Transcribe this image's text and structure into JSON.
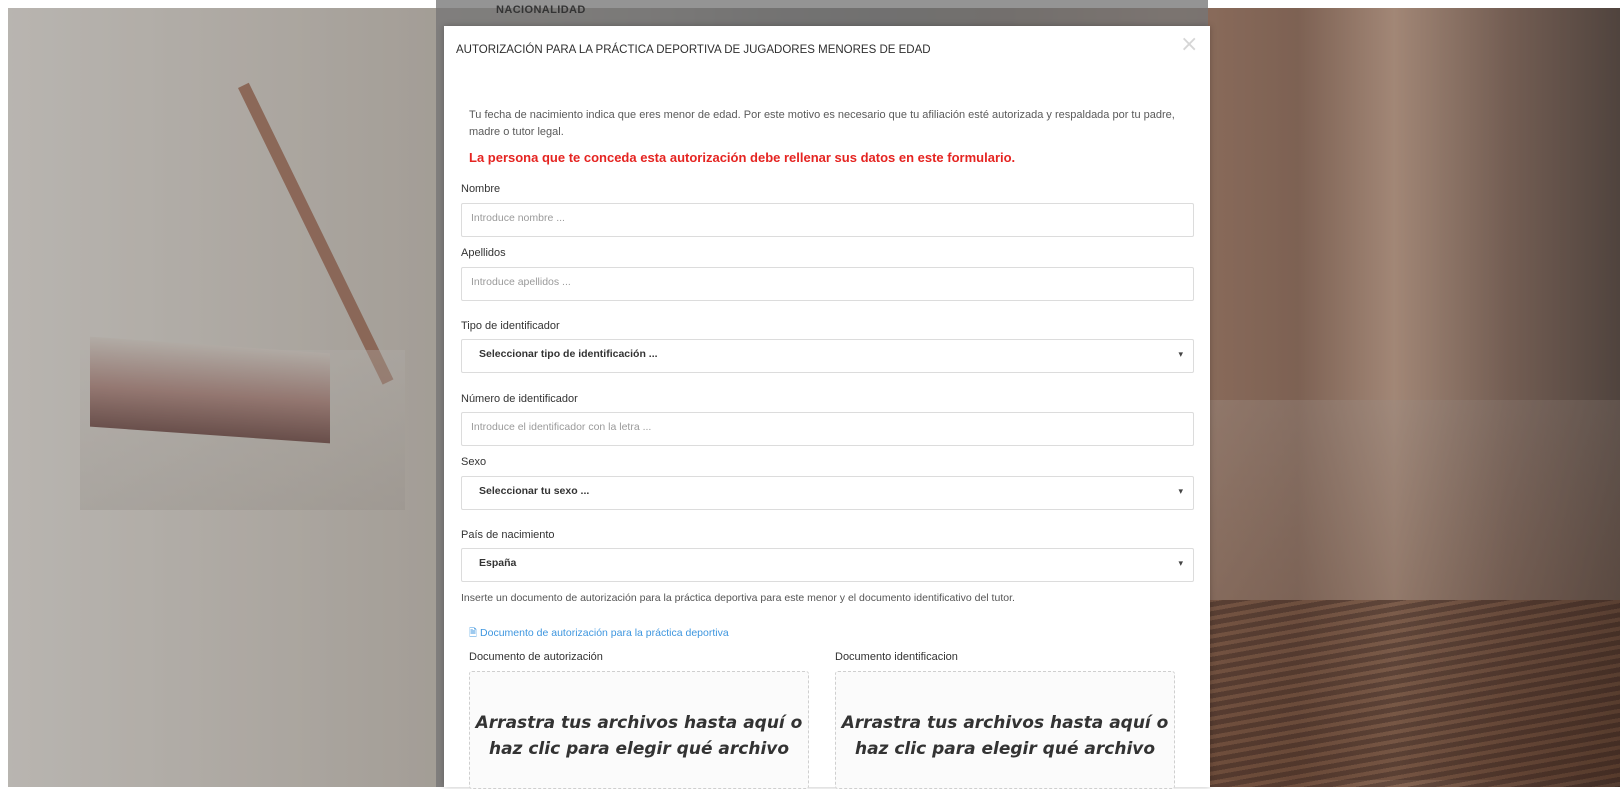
{
  "background": {
    "under_label": "NACIONALIDAD"
  },
  "modal": {
    "title": "AUTORIZACIÓN PARA LA PRÁCTICA DEPORTIVA DE JUGADORES MENORES DE EDAD",
    "close_symbol": "×",
    "intro": "Tu fecha de nacimiento indica que eres menor de edad. Por este motivo es necesario que tu afiliación esté autorizada y respaldada por tu padre, madre o tutor legal.",
    "warning": "La persona que te conceda esta autorización debe rellenar sus datos en este formulario.",
    "fields": {
      "nombre_label": "Nombre",
      "nombre_placeholder": "Introduce nombre ...",
      "apellidos_label": "Apellidos",
      "apellidos_placeholder": "Introduce apellidos ...",
      "tipo_label": "Tipo de identificador",
      "tipo_value": "Seleccionar tipo de identificación ...",
      "numero_label": "Número de identificador",
      "numero_placeholder": "Introduce el identificador con la letra   ...",
      "sexo_label": "Sexo",
      "sexo_value": "Seleccionar tu sexo ...",
      "pais_label": "País de nacimiento",
      "pais_value": "España"
    },
    "documents": {
      "note": "Inserte un documento de autorización para la práctica deportiva para este menor y el documento identificativo del tutor.",
      "link": "Documento de autorización para la práctica deportiva",
      "auth_label": "Documento de autorización",
      "id_label": "Documento identificacion",
      "drop_text": "Arrastra tus archivos hasta aquí o haz clic para elegir qué archivo"
    }
  },
  "icons": {
    "caret": "▾",
    "pdf": "🗎"
  }
}
